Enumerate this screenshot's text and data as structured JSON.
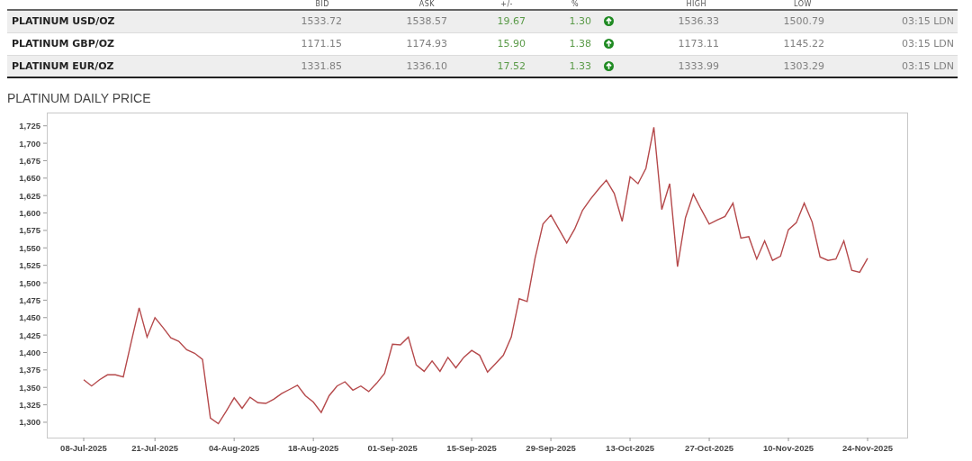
{
  "table": {
    "columns": [
      "BID",
      "ASK",
      "+/-",
      "%",
      "HIGH",
      "LOW"
    ],
    "rows": [
      {
        "name": "PLATINUM USD/OZ",
        "bid": "1533.72",
        "ask": "1538.57",
        "change": "19.67",
        "percent": "1.30",
        "rising": true,
        "high": "1536.33",
        "low": "1500.79",
        "time": "03:15 LDN"
      },
      {
        "name": "PLATINUM GBP/OZ",
        "bid": "1171.15",
        "ask": "1174.93",
        "change": "15.90",
        "percent": "1.38",
        "rising": true,
        "high": "1173.11",
        "low": "1145.22",
        "time": "03:15 LDN"
      },
      {
        "name": "PLATINUM EUR/OZ",
        "bid": "1331.85",
        "ask": "1336.10",
        "change": "17.52",
        "percent": "1.33",
        "rising": true,
        "high": "1333.99",
        "low": "1303.29",
        "time": "03:15 LDN"
      }
    ]
  },
  "chart": {
    "title": "PLATINUM DAILY PRICE",
    "chart_data": {
      "type": "line",
      "categories": [
        "08-Jul-2025",
        null,
        null,
        null,
        null,
        null,
        null,
        null,
        null,
        "21-Jul-2025",
        null,
        null,
        null,
        null,
        null,
        null,
        null,
        null,
        null,
        "04-Aug-2025",
        null,
        null,
        null,
        null,
        null,
        null,
        null,
        null,
        null,
        "18-Aug-2025",
        null,
        null,
        null,
        null,
        null,
        null,
        null,
        null,
        null,
        "01-Sep-2025",
        null,
        null,
        null,
        null,
        null,
        null,
        null,
        null,
        null,
        "15-Sep-2025",
        null,
        null,
        null,
        null,
        null,
        null,
        null,
        null,
        null,
        "29-Sep-2025",
        null,
        null,
        null,
        null,
        null,
        null,
        null,
        null,
        null,
        "13-Oct-2025",
        null,
        null,
        null,
        null,
        null,
        null,
        null,
        null,
        null,
        "27-Oct-2025",
        null,
        null,
        null,
        null,
        null,
        null,
        null,
        null,
        null,
        "10-Nov-2025",
        null,
        null,
        null,
        null,
        null,
        null,
        null,
        null,
        null,
        "24-Nov-2025"
      ],
      "series": [
        {
          "color": "#b5494b",
          "values": [
            1361,
            1352,
            1361,
            1368,
            1368,
            1365,
            1415,
            1464,
            1422,
            1450,
            1436,
            1421,
            1416,
            1404,
            1399,
            1390,
            1306,
            1298,
            1316,
            1335,
            1320,
            1336,
            1328,
            1327,
            1333,
            1341,
            1347,
            1353,
            1338,
            1329,
            1314,
            1338,
            1352,
            1358,
            1346,
            1352,
            1344,
            1356,
            1370,
            1412,
            1411,
            1422,
            1382,
            1373,
            1388,
            1373,
            1393,
            1378,
            1393,
            1403,
            1396,
            1372,
            1384,
            1396,
            1422,
            1477,
            1473,
            1535,
            1584,
            1597,
            1577,
            1557,
            1577,
            1604,
            1620,
            1634,
            1647,
            1628,
            1588,
            1652,
            1642,
            1664,
            1723,
            1605,
            1642,
            1523,
            1593,
            1627,
            1605,
            1584,
            1590,
            1595,
            1614,
            1564,
            1566,
            1534,
            1560,
            1532,
            1538,
            1576,
            1586,
            1614,
            1587,
            1537,
            1532,
            1534,
            1560,
            1518,
            1515,
            1535
          ]
        }
      ],
      "ylim": [
        1278,
        1744
      ],
      "yticks": [
        {
          "value": 1300,
          "label": "1,300"
        },
        {
          "value": 1325,
          "label": "1,325"
        },
        {
          "value": 1350,
          "label": "1,350"
        },
        {
          "value": 1375,
          "label": "1,375"
        },
        {
          "value": 1400,
          "label": "1,400"
        },
        {
          "value": 1425,
          "label": "1,425"
        },
        {
          "value": 1450,
          "label": "1,450"
        },
        {
          "value": 1475,
          "label": "1,475"
        },
        {
          "value": 1500,
          "label": "1,500"
        },
        {
          "value": 1525,
          "label": "1,525"
        },
        {
          "value": 1550,
          "label": "1,550"
        },
        {
          "value": 1575,
          "label": "1,575"
        },
        {
          "value": 1600,
          "label": "1,600"
        },
        {
          "value": 1625,
          "label": "1,625"
        },
        {
          "value": 1650,
          "label": "1,650"
        },
        {
          "value": 1675,
          "label": "1,675"
        },
        {
          "value": 1700,
          "label": "1,700"
        },
        {
          "value": 1725,
          "label": "1,725"
        }
      ]
    }
  }
}
